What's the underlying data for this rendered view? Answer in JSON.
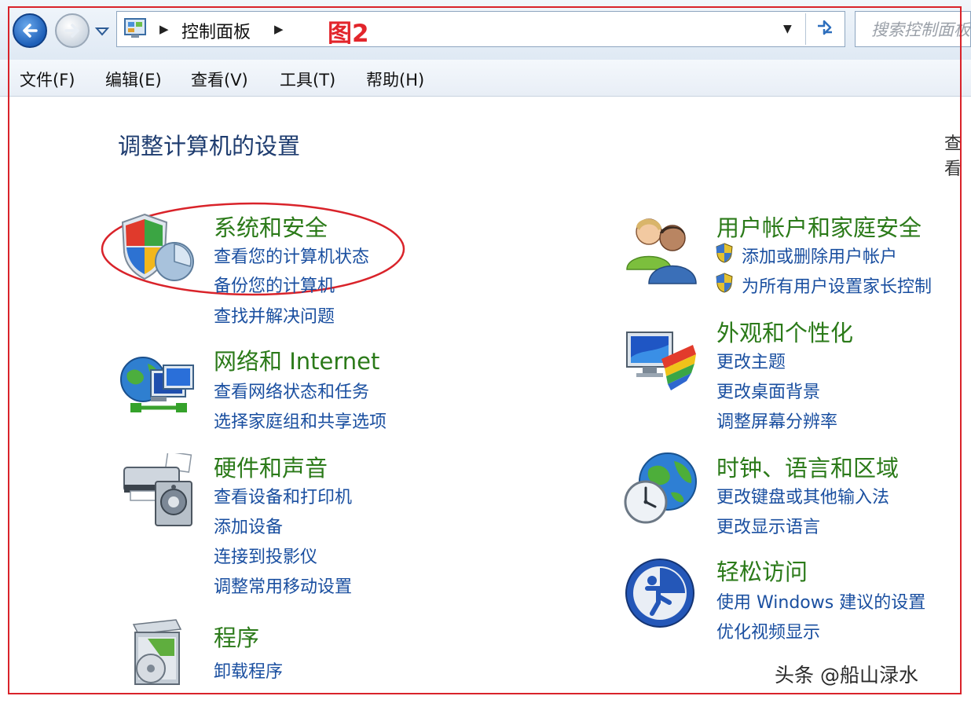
{
  "address_bar": {
    "breadcrumb": "控制面板",
    "annotation": "图2",
    "search_placeholder": "搜索控制面板"
  },
  "menu": {
    "items": [
      "文件(F)",
      "编辑(E)",
      "查看(V)",
      "工具(T)",
      "帮助(H)"
    ]
  },
  "main": {
    "title": "调整计算机的设置",
    "view_by_partial": "查看",
    "categories": [
      {
        "title": "系统和安全",
        "icon": "security-shield-icon",
        "links": [
          "查看您的计算机状态",
          "备份您的计算机",
          "查找并解决问题"
        ]
      },
      {
        "title": "网络和 Internet",
        "icon": "network-globe-icon",
        "links": [
          "查看网络状态和任务",
          "选择家庭组和共享选项"
        ]
      },
      {
        "title": "硬件和声音",
        "icon": "printer-speaker-icon",
        "links": [
          "查看设备和打印机",
          "添加设备",
          "连接到投影仪",
          "调整常用移动设置"
        ]
      },
      {
        "title": "程序",
        "icon": "programs-box-icon",
        "links": [
          "卸载程序"
        ]
      },
      {
        "title": "用户帐户和家庭安全",
        "icon": "users-icon",
        "links": [
          "添加或删除用户帐户",
          "为所有用户设置家长控制"
        ]
      },
      {
        "title": "外观和个性化",
        "icon": "monitor-palette-icon",
        "links": [
          "更改主题",
          "更改桌面背景",
          "调整屏幕分辨率"
        ]
      },
      {
        "title": "时钟、语言和区域",
        "icon": "globe-clock-icon",
        "links": [
          "更改键盘或其他输入法",
          "更改显示语言"
        ]
      },
      {
        "title": "轻松访问",
        "icon": "ease-of-access-icon",
        "links": [
          "使用 Windows 建议的设置",
          "优化视频显示"
        ]
      }
    ]
  },
  "watermark": "头条 @船山渌水",
  "colors": {
    "category_title": "#2b7a19",
    "link": "#1a4fa0",
    "annotation_red": "#d9232a"
  }
}
